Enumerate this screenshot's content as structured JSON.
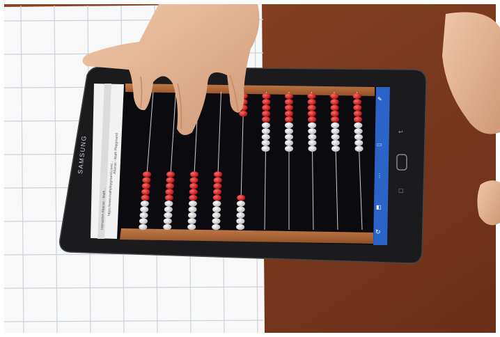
{
  "scene": {
    "brand_text": "SAMSUNG",
    "browser_tab_1": "Interactive Abacus - Math...",
    "browser_tab_2": "Abacus - Math Playground",
    "address_text": "https://www.mathplayground.com/...",
    "abacus": {
      "rods": 10,
      "beads_per_rod": 10,
      "beads_moved_left_per_rod": [
        10,
        10,
        10,
        10,
        6,
        0,
        0,
        0,
        0,
        0
      ]
    },
    "colors": {
      "desk": "#7a3a20",
      "paper": "#f7f7f7",
      "grid_line": "#c9d3dc",
      "tablet_body": "#1a1a1c",
      "screen": "#0c0c10",
      "frame_wood": "#b06a3b",
      "bead_red": "#d11e1e",
      "bead_white": "#e8e8e8",
      "nav_bar": "#2b63c8",
      "skin": "#e6b394"
    }
  }
}
